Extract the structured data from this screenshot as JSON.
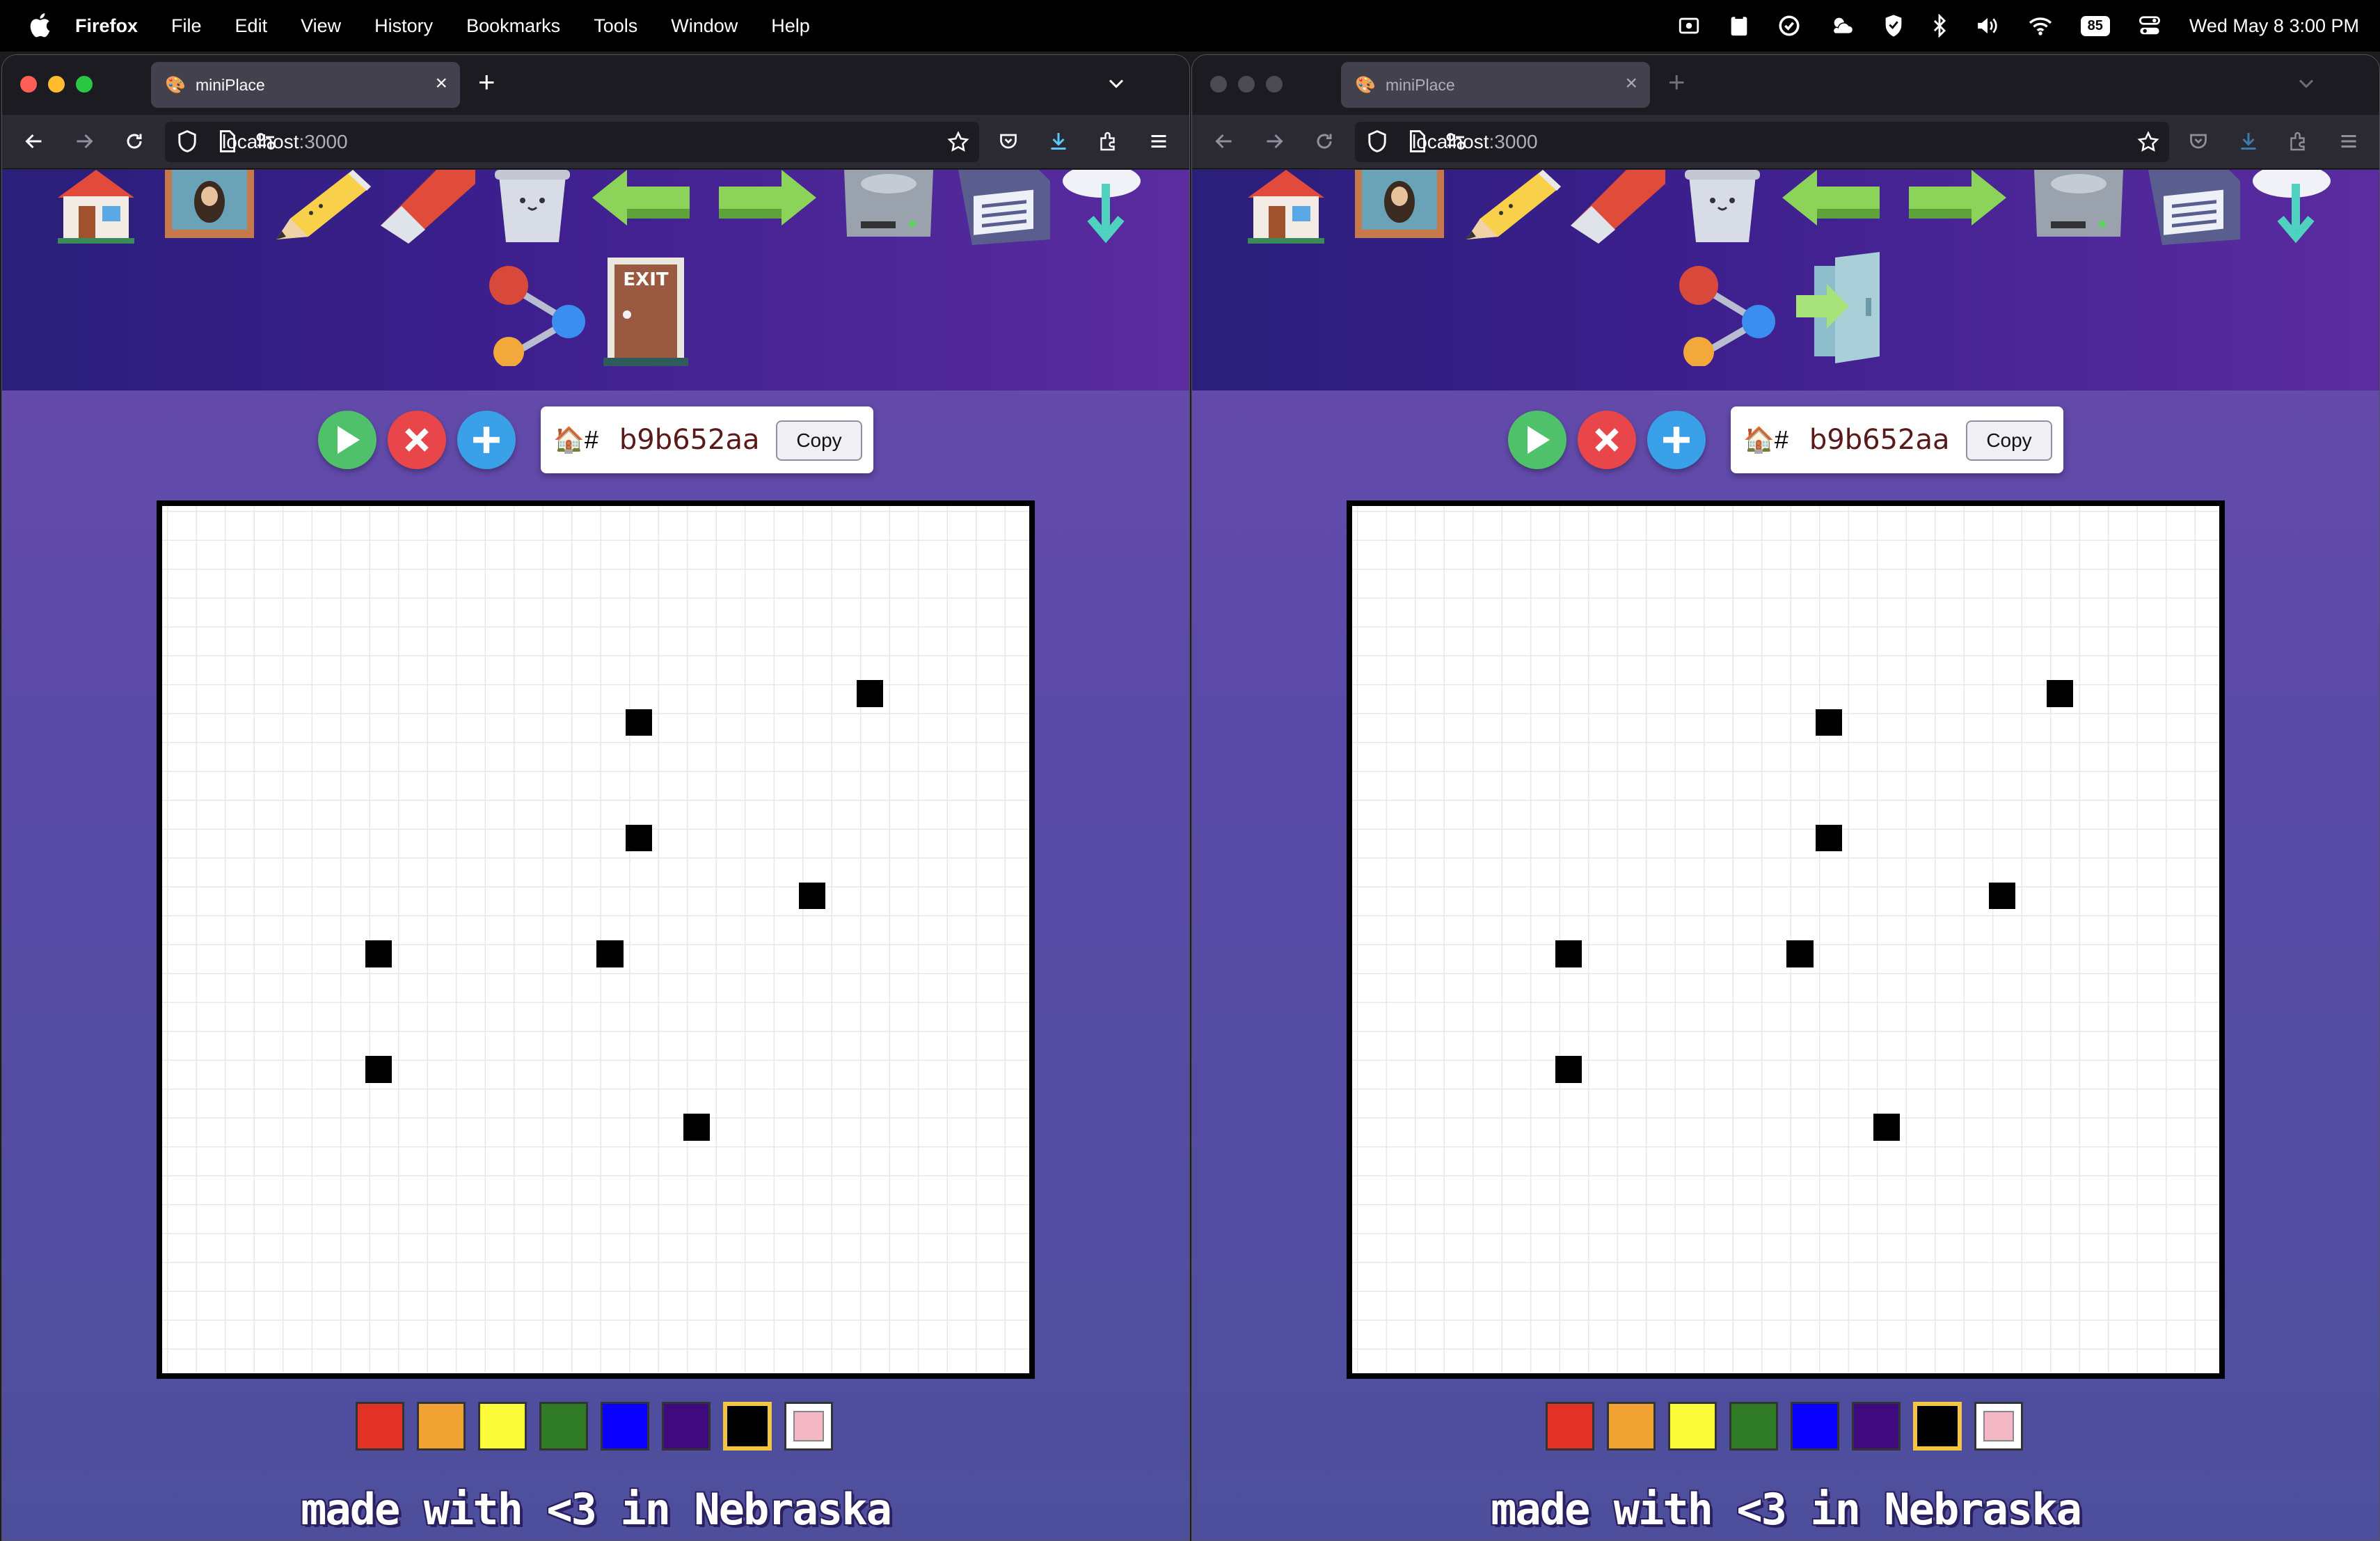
{
  "menubar": {
    "app": "Firefox",
    "items": [
      "File",
      "Edit",
      "View",
      "History",
      "Bookmarks",
      "Tools",
      "Window",
      "Help"
    ],
    "battery": "85",
    "datetime": "Wed May 8  3:00 PM"
  },
  "browser": {
    "tab_title": "miniPlace",
    "url_host": "localhost",
    "url_port": ":3000"
  },
  "toolbar_icons": [
    "home-icon",
    "painting-icon",
    "pencil-icon",
    "eraser-icon",
    "trash-icon",
    "undo-arrow-icon",
    "redo-arrow-icon",
    "hard-drive-icon",
    "save-floppy-icon",
    "download-cloud-icon",
    "share-icon",
    "exit-door-icon"
  ],
  "room": {
    "code": "b9b652aa",
    "copy_label": "Copy",
    "icon_label": "🏠#"
  },
  "board": {
    "grid_size": 30,
    "pixels": [
      {
        "row": 6,
        "col": 24,
        "color": "#000000"
      },
      {
        "row": 7,
        "col": 16,
        "color": "#000000"
      },
      {
        "row": 11,
        "col": 16,
        "color": "#000000"
      },
      {
        "row": 13,
        "col": 22,
        "color": "#000000"
      },
      {
        "row": 15,
        "col": 7,
        "color": "#000000"
      },
      {
        "row": 15,
        "col": 15,
        "color": "#000000"
      },
      {
        "row": 19,
        "col": 7,
        "color": "#000000"
      },
      {
        "row": 21,
        "col": 18,
        "color": "#000000"
      }
    ]
  },
  "palette": {
    "colors": [
      "#e23226",
      "#f0a233",
      "#fcfc3b",
      "#2f7a24",
      "#0a00ff",
      "#3f0a7d",
      "#000000",
      "#f4b8c4"
    ],
    "selected": 6
  },
  "footer": "made with <3 in Nebraska"
}
